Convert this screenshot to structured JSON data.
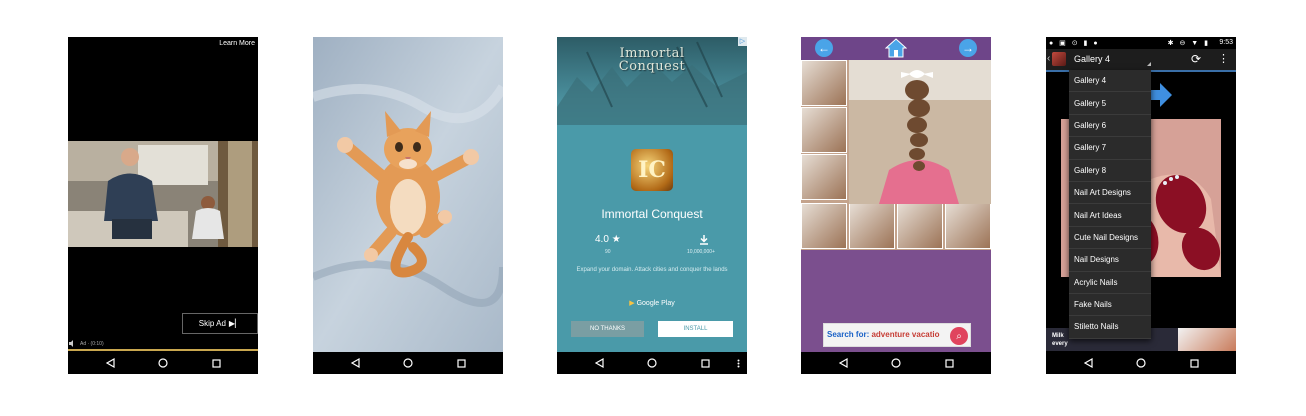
{
  "screen1": {
    "learn_more": "Learn More",
    "skip_ad": "Skip Ad",
    "ad_time": "Ad · (0:10)",
    "accent": "#c9a74f"
  },
  "screen2": {
    "background": "#b6c4d2"
  },
  "screen3": {
    "banner_title": "Immortal Conquest",
    "app_name": "Immortal Conquest",
    "rating": "4.0",
    "reviews": "90",
    "installs": "10,000,000+",
    "description": "Expand your domain. Attack cities and conquer the lands",
    "store": "Google Play",
    "no_thanks": "NO THANKS",
    "install": "INSTALL",
    "background": "#4a9aa9"
  },
  "screen4": {
    "ad_search_prefix": "Search for:",
    "ad_search_term": "adventure vacatio",
    "background": "#7b4f8e"
  },
  "screen5": {
    "time": "9:53",
    "title": "Gallery 4",
    "dropdown": [
      "Gallery 4",
      "Gallery 5",
      "Gallery 6",
      "Gallery 7",
      "Gallery 8",
      "Nail Art Designs",
      "Nail Art Ideas",
      "Cute Nail Designs",
      "Nail Designs",
      "Acrylic Nails",
      "Fake Nails",
      "Stiletto Nails"
    ],
    "ad_text_1": "Milk",
    "ad_text_2": "every",
    "accent": "#3a6fa8"
  }
}
